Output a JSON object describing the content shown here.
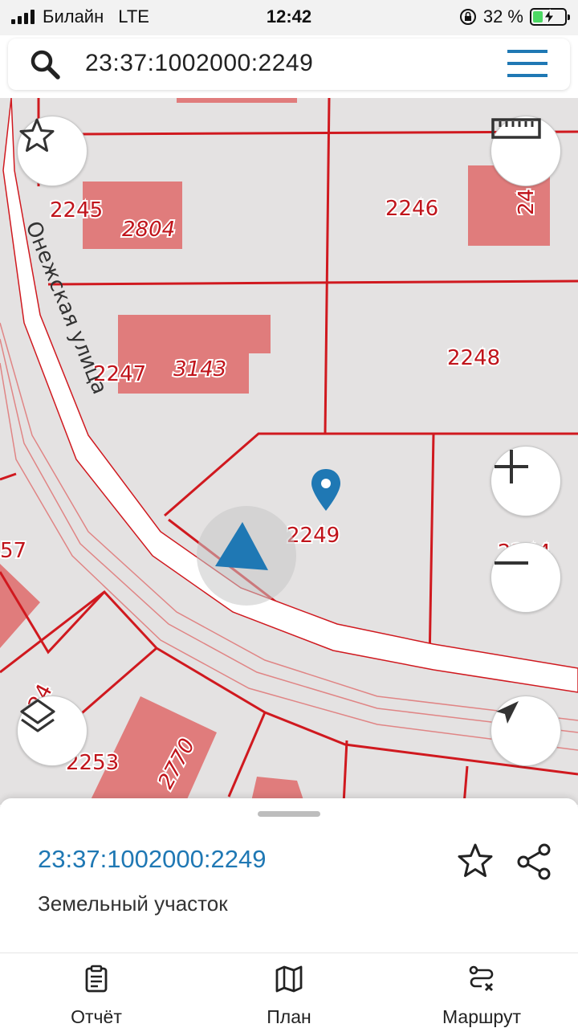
{
  "status_bar": {
    "carrier": "Билайн",
    "network": "LTE",
    "time": "12:42",
    "battery_percent": "32 %",
    "battery_level": 0.32
  },
  "search": {
    "query": "23:37:1002000:2249",
    "icon": "search-icon",
    "menu_icon": "hamburger-menu-icon"
  },
  "map": {
    "plots": [
      "2245",
      "2804",
      "2246",
      "2247",
      "3143",
      "2248",
      "2249",
      "2244",
      "2253",
      "2770"
    ],
    "partial_labels": [
      "57",
      "24",
      "24"
    ],
    "street": "Онежская улица",
    "buttons": [
      "star-icon",
      "ruler-icon",
      "zoom-in-icon",
      "zoom-out-icon",
      "layers-icon",
      "navigate-icon"
    ]
  },
  "sheet": {
    "cadastral_number": "23:37:1002000:2249",
    "object_type": "Земельный участок"
  },
  "tabs": [
    {
      "label": "Отчёт",
      "icon": "report-clipboard-icon"
    },
    {
      "label": "План",
      "icon": "map-plan-icon"
    },
    {
      "label": "Маршрут",
      "icon": "route-icon"
    }
  ],
  "colors": {
    "accent": "#1f78b4",
    "parcel_border": "#d0191f",
    "building_fill": "#e07c7c",
    "map_background": "#e4e2e2"
  }
}
